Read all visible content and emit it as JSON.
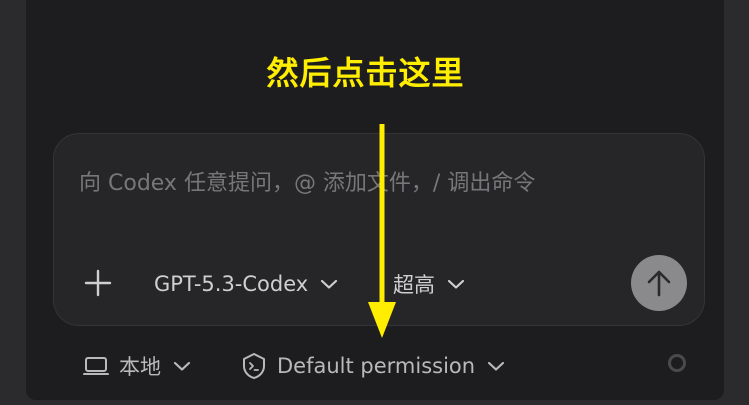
{
  "annotation": {
    "text": "然后点击这里",
    "color": "#ffee00"
  },
  "composer": {
    "placeholder": "向 Codex 任意提问，@ 添加文件，/ 调出命令",
    "model_label": "GPT-5.3-Codex",
    "effort_label": "超高",
    "add_icon": "plus-icon",
    "send_icon": "arrow-up-icon"
  },
  "footer": {
    "location_label": "本地",
    "location_icon": "laptop-icon",
    "permission_label": "Default permission",
    "permission_icon": "shield-terminal-icon",
    "status_icon": "circle-status-icon"
  },
  "colors": {
    "background": "#2b2b2d",
    "panel": "#1d1d1f",
    "composer": "#262628",
    "send_button": "#8a8a8d",
    "annotation_arrow": "#ffee00"
  }
}
